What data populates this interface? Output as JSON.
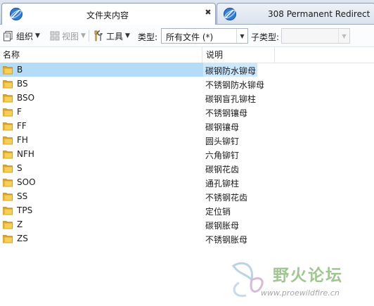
{
  "tabs": [
    {
      "title": "文件夹内容",
      "close": "✖"
    },
    {
      "title": "308 Permanent Redirect"
    }
  ],
  "toolbar": {
    "organize": "组织",
    "view": "视图",
    "tools": "工具",
    "type_label": "类型:",
    "type_value": "所有文件 (*)",
    "subtype_label": "子类型:",
    "subtype_value": ""
  },
  "columns": {
    "name": "名称",
    "desc": "说明"
  },
  "rows": [
    {
      "name": "B",
      "desc": "碳钢防水铆母"
    },
    {
      "name": "BS",
      "desc": "不锈钢防水铆母"
    },
    {
      "name": "BSO",
      "desc": "碳钢盲孔铆柱"
    },
    {
      "name": "F",
      "desc": "不锈钢镶母"
    },
    {
      "name": "FF",
      "desc": "碳钢镶母"
    },
    {
      "name": "FH",
      "desc": "圆头铆钉"
    },
    {
      "name": "NFH",
      "desc": "六角铆钉"
    },
    {
      "name": "S",
      "desc": "碳钢花齿"
    },
    {
      "name": "SOO",
      "desc": "通孔铆柱"
    },
    {
      "name": "SS",
      "desc": "不锈钢花齿"
    },
    {
      "name": "TPS",
      "desc": "定位销"
    },
    {
      "name": "Z",
      "desc": "碳钢胀母"
    },
    {
      "name": "ZS",
      "desc": "不锈钢胀母"
    }
  ],
  "selected_row": 0,
  "watermark": {
    "title": "野火论坛",
    "url": "www.proewildfire.cn"
  },
  "colors": {
    "selection": "#cce8ff",
    "folder": "#f2c447",
    "accent_blue": "#1f6fc5"
  }
}
